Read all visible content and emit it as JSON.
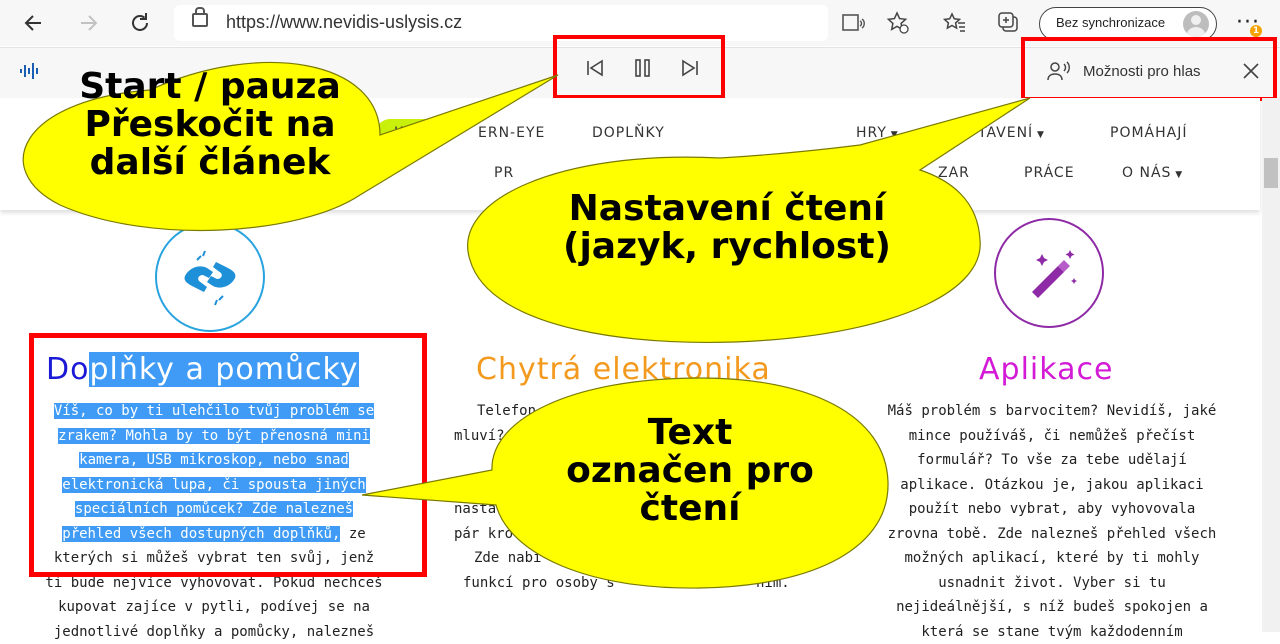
{
  "browser": {
    "url": "https://www.nevidis-uslysis.cz",
    "sync_label": "Bez synchronizace",
    "notification_count": "1",
    "ellipsis": "···"
  },
  "reader_bar": {
    "voice_options_label": "Možnosti pro hlas"
  },
  "site_nav": {
    "row1": [
      "KA",
      "ERN-EYE",
      "DOPLŇKY",
      "HRY",
      "TAVENÍ",
      "POMÁHAJÍ"
    ],
    "row2": [
      "PR",
      "ZAR",
      "PRÁCE",
      "O NÁS"
    ]
  },
  "columns": [
    {
      "title_plain": "Do",
      "title_highlight": "plňky a pomůcky ",
      "title_color": "#1a1ad6",
      "lines_highlighted": [
        "Víš, co by ti ulehčilo tvůj problém se",
        "zrakem? Mohla by to být přenosná mini",
        "kamera, USB mikroskop, nebo snad",
        "elektronická lupa, či spousta jiných",
        "speciálních pomůcek? Zde nalezneš",
        "přehled všech dostupných doplňků,"
      ],
      "lines_plain_after": " ze",
      "lines_plain": [
        "kterých si můžeš vybrat ten svůj, jenž",
        "ti bude nejvíce vyhovovat. Pokud nechceš",
        "kupovat zajíce v pytli, podívej se na",
        "jednotlivé doplňky a pomůcky, nalezneš"
      ]
    },
    {
      "title": "Chytrá elektronika",
      "title_color": "#f39a1e",
      "lines": [
        "Telefon",
        "mluví?",
        "",
        "",
        "nasta",
        "pár kro",
        "Zde nabí",
        "funkcí pro osoby s",
        "ním."
      ]
    },
    {
      "title": "Aplikace",
      "title_color": "#d31ad6",
      "lines": [
        "Máš problém s barvocitem? Nevidíš, jaké",
        "mince používáš, či nemůžeš přečíst",
        "formulář? To vše za tebe udělají",
        "aplikace. Otázkou je, jakou aplikaci",
        "použít nebo vybrat, aby vyhovovala",
        "zrovna tobě. Zde nalezneš přehled všech",
        "možných aplikací, které by ti mohly",
        "usnadnit život. Vyber si tu",
        "nejideálnější, s níž budeš spokojen a",
        "která se stane tvým každodenním"
      ]
    }
  ],
  "callouts": {
    "left": [
      "Start / pauza",
      "Přeskočit na",
      "další článek"
    ],
    "middle": [
      "Nastavení čtení",
      "(jazyk, rychlost)"
    ],
    "bottom": [
      "Text",
      "označen pro",
      "čtení"
    ]
  },
  "colors": {
    "annotation_red": "#ff0000",
    "callout_yellow": "#ffff00",
    "highlight_blue": "#3f9bf5",
    "nav_pill_green": "#c8f00a"
  }
}
